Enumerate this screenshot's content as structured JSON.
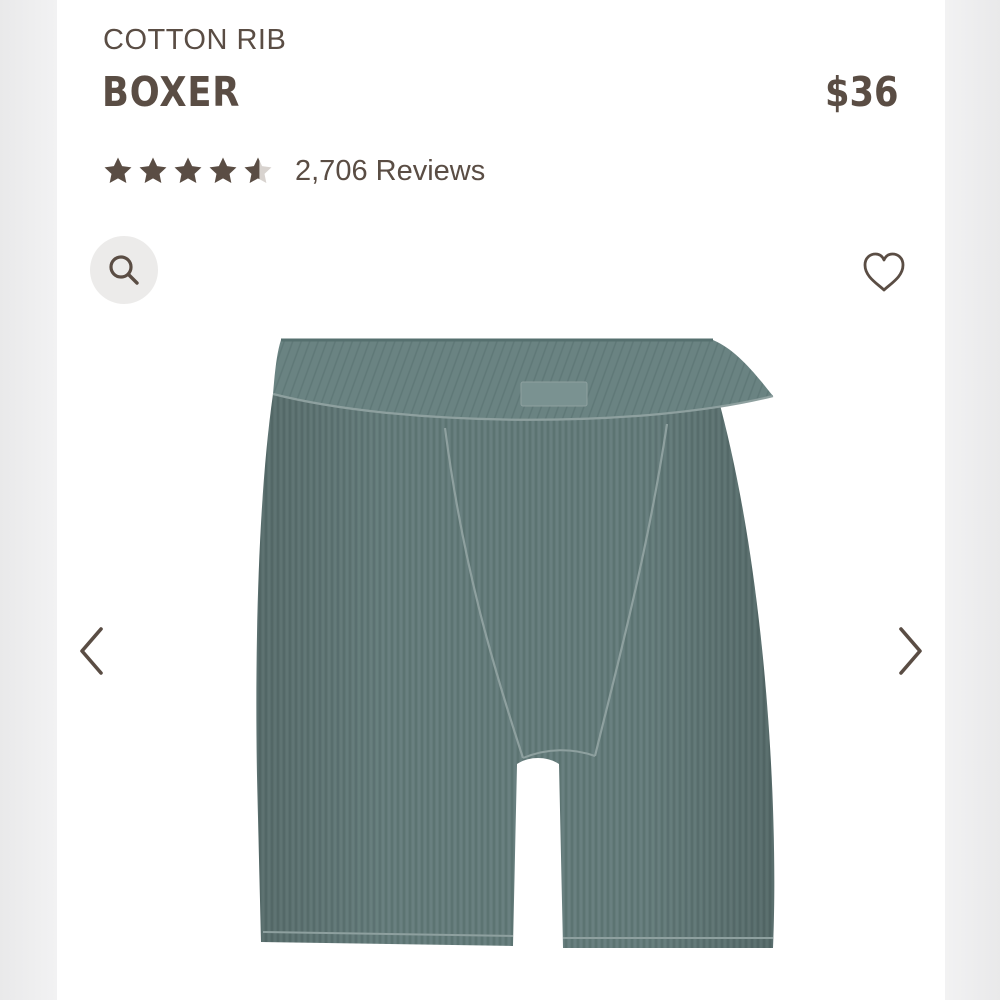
{
  "product": {
    "subtitle": "COTTON RIB",
    "title": "BOXER",
    "price": "$36",
    "rating_value": 4.5,
    "rating_max": 5,
    "reviews_label": "2,706 Reviews",
    "image_description_icon": "boxer-shorts-image",
    "color": "#647b7a"
  },
  "icons": {
    "zoom": "search-icon",
    "wishlist": "heart-icon",
    "prev": "chevron-left-icon",
    "next": "chevron-right-icon"
  },
  "colors": {
    "text": "#5a4d44",
    "zoom_bg": "#ecebea",
    "background": "#ffffff"
  }
}
